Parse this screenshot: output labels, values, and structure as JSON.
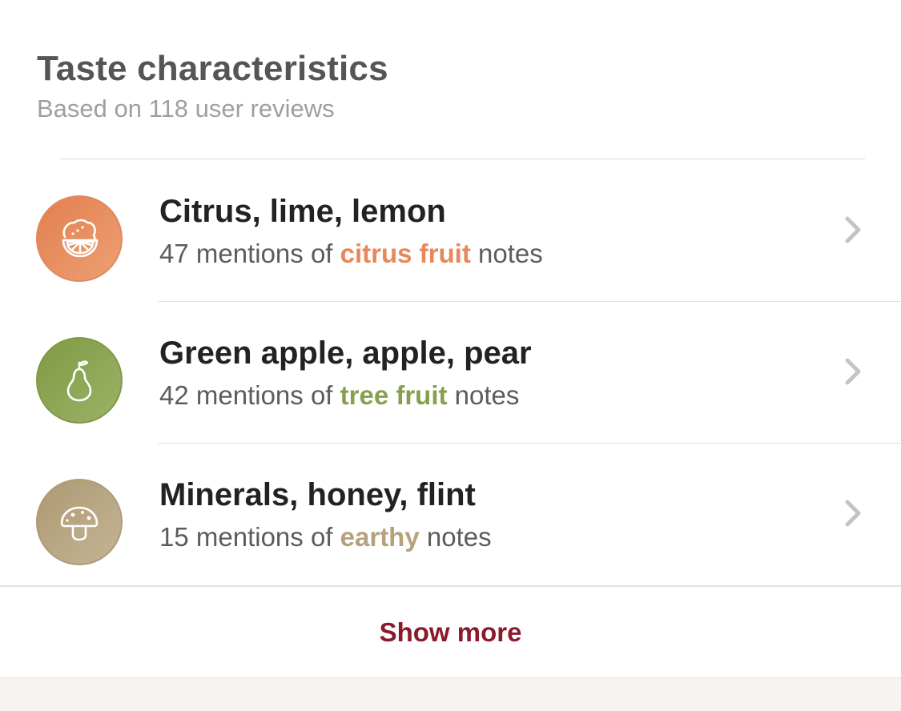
{
  "header": {
    "title": "Taste characteristics",
    "subtitle": "Based on 118 user reviews"
  },
  "rows": [
    {
      "title": "Citrus, lime, lemon",
      "count_prefix": "47 mentions of ",
      "highlight": "citrus fruit",
      "suffix": " notes",
      "icon": "lemon-icon",
      "color": "#e8875a"
    },
    {
      "title": "Green apple, apple, pear",
      "count_prefix": "42 mentions of ",
      "highlight": "tree fruit",
      "suffix": " notes",
      "icon": "pear-icon",
      "color": "#87a04e"
    },
    {
      "title": "Minerals, honey, flint",
      "count_prefix": "15 mentions of ",
      "highlight": "earthy",
      "suffix": " notes",
      "icon": "mushroom-icon",
      "color": "#b5a27c"
    }
  ],
  "footer": {
    "show_more_label": "Show more",
    "show_more_color": "#8b1a2a"
  }
}
